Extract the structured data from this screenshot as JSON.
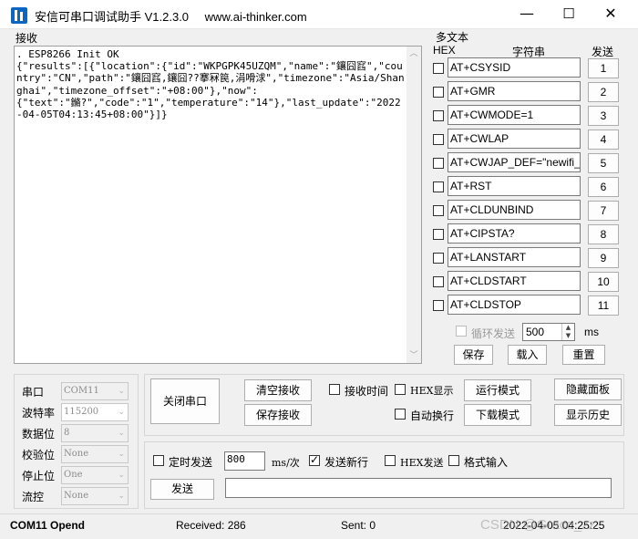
{
  "window": {
    "title": "安信可串口调试助手 V1.2.3.0",
    "website": "www.ai-thinker.com",
    "minimize": "—",
    "maximize": "☐",
    "close": "✕"
  },
  "receive": {
    "label": "接收",
    "content": ". ESP8266 Init OK\n{\"results\":[{\"location\":{\"id\":\"WKPGPK45UZQM\",\"name\":\"鑲囧窞\",\"country\":\"CN\",\"path\":\"鑲囧窞,鑲囧??搴冧笢,涓嗗浗\",\"timezone\":\"Asia/Shanghai\",\"timezone_offset\":\"+08:00\"},\"now\":\n{\"text\":\"鏅?\",\"code\":\"1\",\"temperature\":\"14\"},\"last_update\":\"2022-04-05T04:13:45+08:00\"}]}"
  },
  "multi_text": {
    "title": "多文本",
    "hex_header": "HEX",
    "string_header": "字符串",
    "send_header": "发送",
    "rows": [
      {
        "value": "AT+CSYSID",
        "num": "1"
      },
      {
        "value": "AT+GMR",
        "num": "2"
      },
      {
        "value": "AT+CWMODE=1",
        "num": "3"
      },
      {
        "value": "AT+CWLAP",
        "num": "4"
      },
      {
        "value": "AT+CWJAP_DEF=\"newifi_",
        "num": "5"
      },
      {
        "value": "AT+RST",
        "num": "6"
      },
      {
        "value": "AT+CLDUNBIND",
        "num": "7"
      },
      {
        "value": "AT+CIPSTA?",
        "num": "8"
      },
      {
        "value": "AT+LANSTART",
        "num": "9"
      },
      {
        "value": "AT+CLDSTART",
        "num": "10"
      },
      {
        "value": "AT+CLDSTOP",
        "num": "11"
      }
    ],
    "loop_send": "循环发送",
    "loop_interval": "500",
    "loop_unit": "ms",
    "save": "保存",
    "load": "载入",
    "reset": "重置"
  },
  "port_settings": {
    "port_label": "串口",
    "port_value": "COM11",
    "baud_label": "波特率",
    "baud_value": "115200",
    "data_label": "数据位",
    "data_value": "8",
    "parity_label": "校验位",
    "parity_value": "None",
    "stop_label": "停止位",
    "stop_value": "One",
    "flow_label": "流控",
    "flow_value": "None"
  },
  "controls": {
    "close_port": "关闭串口",
    "clear_receive": "清空接收",
    "save_receive": "保存接收",
    "receive_time": "接收时间",
    "hex_display": "HEX显示",
    "auto_wrap": "自动换行",
    "run_mode": "运行模式",
    "download_mode": "下载模式",
    "hide_panel": "隐藏面板",
    "show_history": "显示历史"
  },
  "send": {
    "timed_send": "定时发送",
    "interval": "800",
    "interval_unit": "ms/次",
    "send_newline": "发送新行",
    "hex_send": "HEX发送",
    "format_input": "格式输入",
    "send_button": "发送",
    "send_text": ""
  },
  "status": {
    "port_state": "COM11 Opend",
    "received": "Received: 286",
    "sent": "Sent: 0",
    "time": "2022-04-05 04:25:25",
    "watermark": "CSDN @Grace_zz"
  }
}
